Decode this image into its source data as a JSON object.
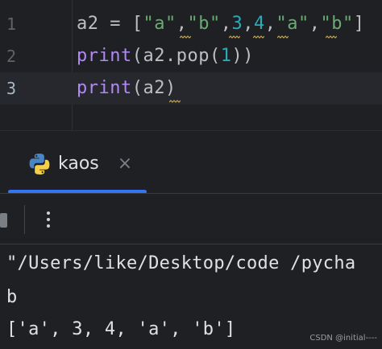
{
  "editor": {
    "lines": [
      {
        "number": "1",
        "tokens": [
          "a2",
          " = ",
          "[",
          "\"a\"",
          ",",
          "\"b\"",
          ",",
          "3",
          ",",
          "4",
          ",",
          "\"a\"",
          ",",
          "\"b\"",
          "]"
        ]
      },
      {
        "number": "2",
        "tokens": [
          "print",
          "(",
          "a2",
          ".pop(",
          "1",
          "))"
        ]
      },
      {
        "number": "3",
        "tokens": [
          "print",
          "(",
          "a2",
          ")"
        ]
      }
    ],
    "current_line": "3"
  },
  "run_panel": {
    "tab_label": "kaos",
    "tab_icon": "python-icon",
    "close_icon": "close-icon",
    "toolbar_icon": "more-vertical-icon"
  },
  "console": {
    "lines": [
      "\"/Users/like/Desktop/code /pycha",
      "b",
      "['a', 3, 4, 'a', 'b']"
    ]
  },
  "watermark": "CSDN @initial----",
  "colors": {
    "background": "#1f2023",
    "string": "#6aab73",
    "number": "#2aacb8",
    "builtin": "#b189f5",
    "accent": "#3574f0"
  }
}
